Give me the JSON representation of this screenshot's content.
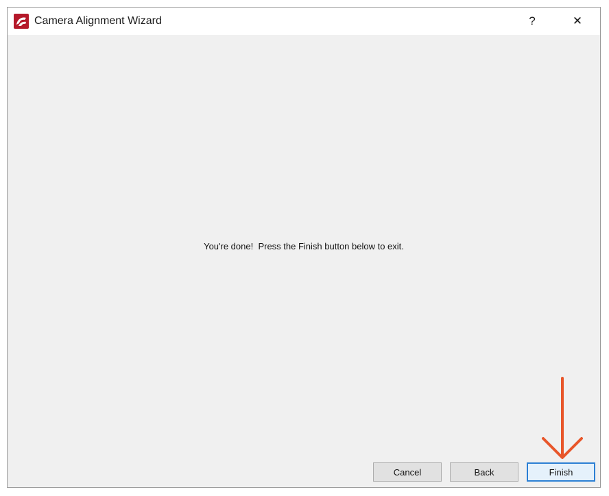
{
  "window": {
    "title": "Camera Alignment Wizard",
    "help_label": "?",
    "close_label": "✕"
  },
  "content": {
    "message": "You're done!  Press the Finish button below to exit."
  },
  "buttons": {
    "cancel": "Cancel",
    "back": "Back",
    "finish": "Finish"
  },
  "colors": {
    "accent": "#2b7fd4",
    "annotation_arrow": "#e8562a",
    "app_icon": "#b5192a"
  },
  "icons": {
    "app": "app-logo-icon",
    "help": "help-icon",
    "close": "close-icon",
    "annotation": "down-arrow-annotation-icon"
  }
}
